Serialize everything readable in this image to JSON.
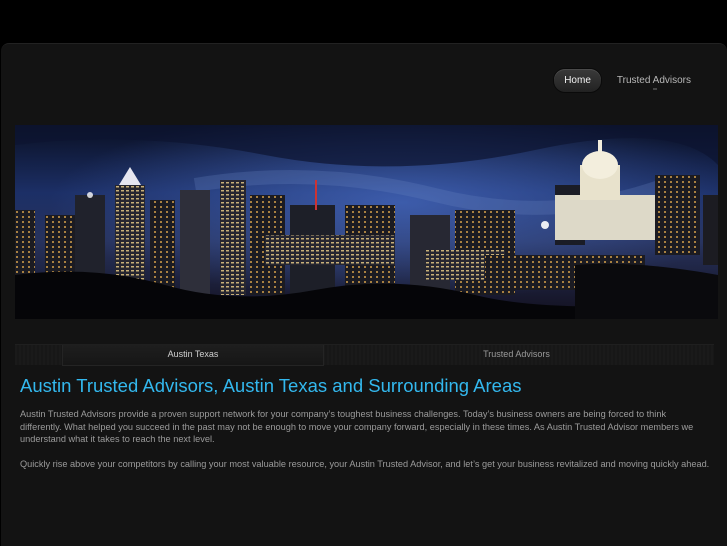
{
  "nav": {
    "items": [
      {
        "label": "Home",
        "active": true
      },
      {
        "label": "Trusted Advisors",
        "active": false
      }
    ]
  },
  "banner": {
    "description": "city-skyline-night-image"
  },
  "tabs": [
    {
      "label": "Austin Texas"
    },
    {
      "label": "Trusted Advisors"
    }
  ],
  "main": {
    "title": "Austin Trusted Advisors, Austin Texas and Surrounding Areas",
    "paragraphs": [
      "Austin Trusted Advisors provide a proven support network for your company’s toughest business challenges. Today’s business owners are being forced to think differently. What helped you succeed in the past may not be enough to move your company forward, especially in these times. As Austin Trusted Advisor members we understand what it takes to reach the next level.",
      "Quickly rise above your competitors by calling your most valuable resource, your Austin Trusted Advisor, and let’s get your business revitalized and moving quickly ahead."
    ]
  },
  "colors": {
    "accent": "#33b8ee",
    "background": "#131313",
    "page": "#000000"
  }
}
